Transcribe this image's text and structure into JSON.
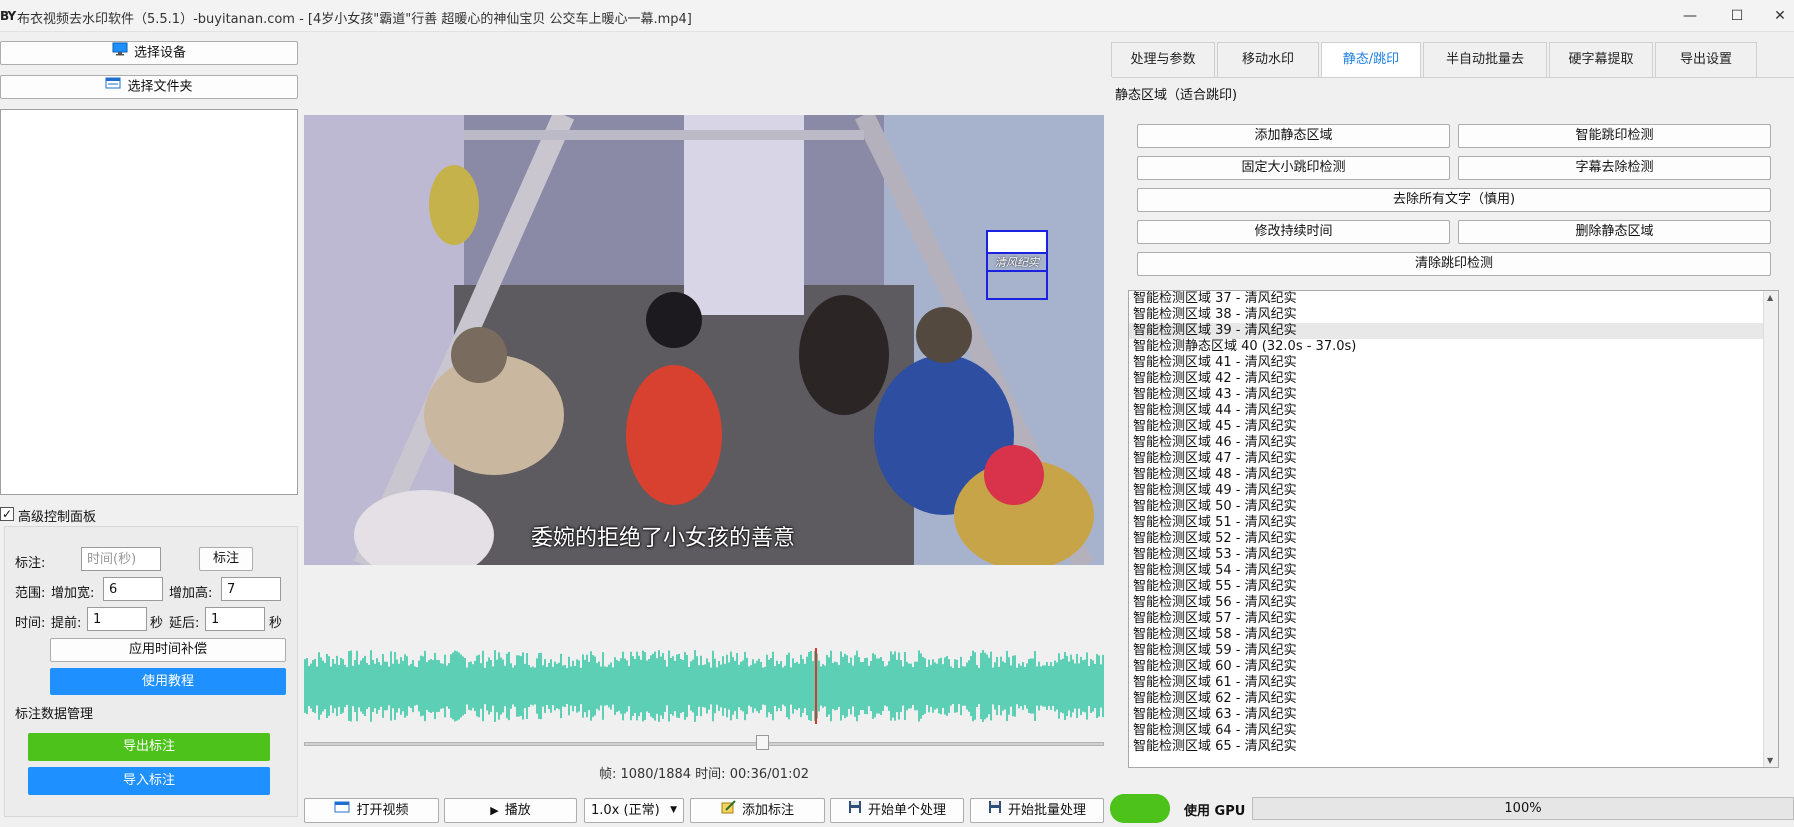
{
  "window": {
    "logo": "BY",
    "title": "布衣视频去水印软件（5.5.1）-buyitanan.com - [4岁小女孩\"霸道\"行善 超暖心的神仙宝贝 公交车上暖心一幕.mp4]",
    "minimize": "—",
    "maximize": "☐",
    "close": "✕"
  },
  "left": {
    "select_device": "选择设备",
    "select_folder": "选择文件夹",
    "advanced_checkbox": "高级控制面板",
    "annotate_label": "标注:",
    "time_placeholder": "时间(秒)",
    "annotate_button": "标注",
    "range_label": "范围:",
    "add_width_label": "增加宽:",
    "add_width_value": "6",
    "add_height_label": "增加高:",
    "add_height_value": "7",
    "time_label": "时间:",
    "before_label": "提前:",
    "before_value": "1",
    "sec1": "秒",
    "after_label": "延后:",
    "after_value": "1",
    "sec2": "秒",
    "apply_comp": "应用时间补偿",
    "tutorial": "使用教程",
    "data_mgmt": "标注数据管理",
    "export_ann": "导出标注",
    "import_ann": "导入标注"
  },
  "video": {
    "subtitle": "委婉的拒绝了小女孩的善意",
    "watermark": "清风纪实",
    "frame_info": "帧: 1080/1884  时间: 00:36/01:02",
    "progress": 0.573
  },
  "bottom": {
    "open_video": "打开视频",
    "play": "播放",
    "speed": "1.0x (正常)",
    "add_annotation": "添加标注",
    "start_single": "开始单个处理",
    "start_batch": "开始批量处理",
    "use_gpu": "使用 GPU",
    "gpu_percent": "100%"
  },
  "tabs": [
    "处理与参数",
    "移动水印",
    "静态/跳印",
    "半自动批量去",
    "硬字幕提取",
    "导出设置"
  ],
  "active_tab": 2,
  "right": {
    "section_title": "静态区域（适合跳印)",
    "add_static": "添加静态区域",
    "smart_jump": "智能跳印检测",
    "fixed_jump": "固定大小跳印检测",
    "subtitle_remove": "字幕去除检测",
    "remove_all_text": "去除所有文字（慎用)",
    "modify_duration": "修改持续时间",
    "delete_static": "删除静态区域",
    "clear_jump": "清除跳印检测"
  },
  "list_items": [
    "智能检测区域 37 - 清风纪实",
    "智能检测区域 38 - 清风纪实",
    "智能检测区域 39 - 清风纪实",
    "智能检测静态区域 40 (32.0s - 37.0s)",
    "智能检测区域 41 - 清风纪实",
    "智能检测区域 42 - 清风纪实",
    "智能检测区域 43 - 清风纪实",
    "智能检测区域 44 - 清风纪实",
    "智能检测区域 45 - 清风纪实",
    "智能检测区域 46 - 清风纪实",
    "智能检测区域 47 - 清风纪实",
    "智能检测区域 48 - 清风纪实",
    "智能检测区域 49 - 清风纪实",
    "智能检测区域 50 - 清风纪实",
    "智能检测区域 51 - 清风纪实",
    "智能检测区域 52 - 清风纪实",
    "智能检测区域 53 - 清风纪实",
    "智能检测区域 54 - 清风纪实",
    "智能检测区域 55 - 清风纪实",
    "智能检测区域 56 - 清风纪实",
    "智能检测区域 57 - 清风纪实",
    "智能检测区域 58 - 清风纪实",
    "智能检测区域 59 - 清风纪实",
    "智能检测区域 60 - 清风纪实",
    "智能检测区域 61 - 清风纪实",
    "智能检测区域 62 - 清风纪实",
    "智能检测区域 63 - 清风纪实",
    "智能检测区域 64 - 清风纪实",
    "智能检测区域 65 - 清风纪实"
  ],
  "selected_index": 2,
  "colors": {
    "accent_blue": "#1e90ff",
    "green": "#4cc21b",
    "tab_active_text": "#1e7fe0",
    "waveform": "#5ccfb4",
    "playhead": "#d63a2f"
  }
}
